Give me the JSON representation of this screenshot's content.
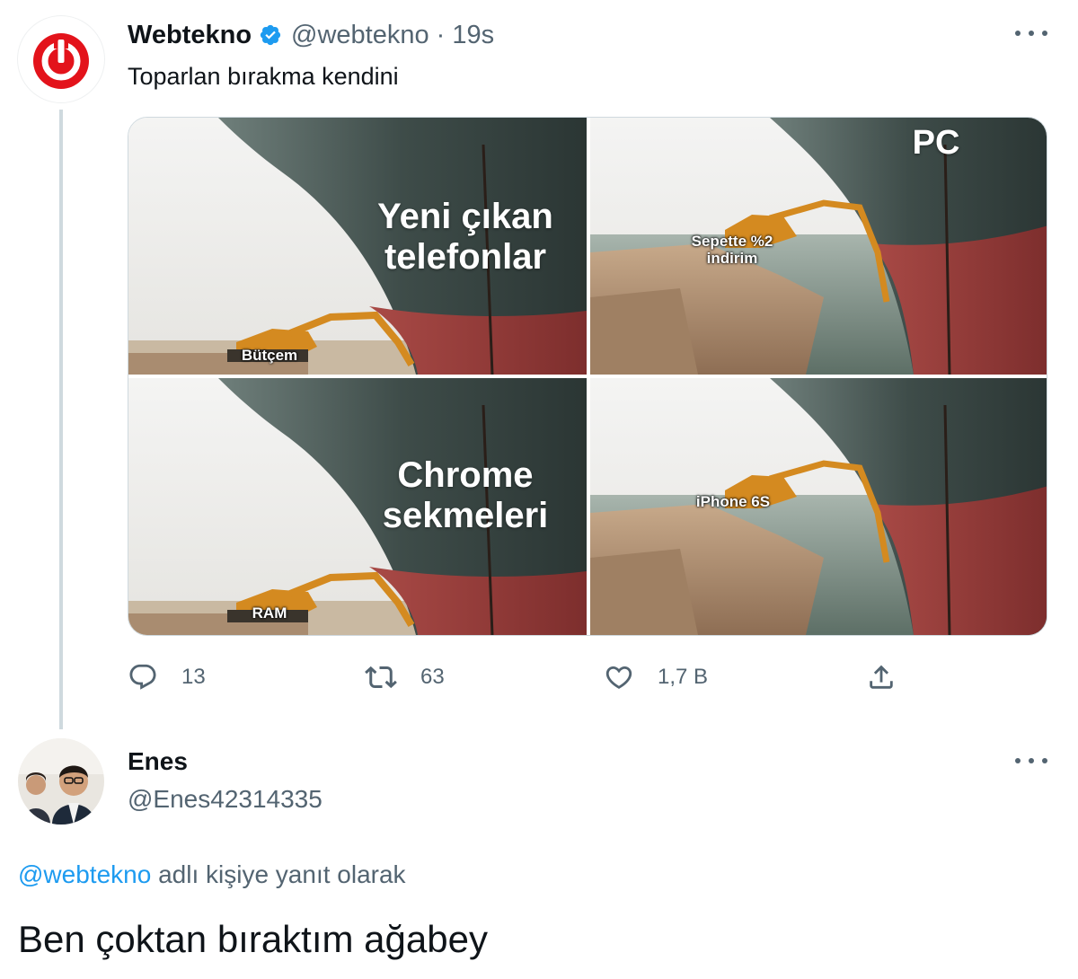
{
  "tweet": {
    "author_name": "Webtekno",
    "author_handle": "@webtekno",
    "separator": "·",
    "time": "19s",
    "text": "Toparlan bırakma kendini",
    "media": {
      "tile1": {
        "main_caption": [
          "Yeni çıkan",
          "telefonlar"
        ],
        "excavator_label": "Bütçem"
      },
      "tile2": {
        "corner_caption": "PC",
        "excavator_label": [
          "Sepette %2",
          "indirim"
        ]
      },
      "tile3": {
        "main_caption": [
          "Chrome",
          "sekmeleri"
        ],
        "excavator_label": "RAM"
      },
      "tile4": {
        "excavator_label": "iPhone 6S"
      }
    },
    "actions": {
      "reply_count": "13",
      "retweet_count": "63",
      "like_count": "1,7 B"
    }
  },
  "reply": {
    "author_name": "Enes",
    "author_handle": "@Enes42314335",
    "reply_to_mention": "@webtekno",
    "reply_to_suffix": " adlı kişiye yanıt olarak",
    "text": "Ben çoktan bıraktım ağabey"
  },
  "colors": {
    "accent": "#1d9bf0",
    "secondary_text": "#536471",
    "brand_red": "#e3131b"
  },
  "icons": [
    "webtekno-logo",
    "verified-badge-icon",
    "more-icon",
    "reply-icon",
    "retweet-icon",
    "like-icon",
    "share-icon"
  ]
}
